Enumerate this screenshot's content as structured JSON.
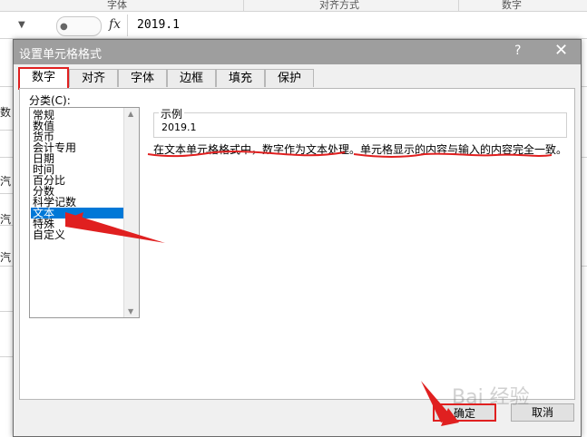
{
  "ribbon": {
    "groups": [
      "字体",
      "对齐方式",
      "数字"
    ]
  },
  "formula_bar": {
    "fx_label": "fx",
    "value": "2019.1"
  },
  "sheet": {
    "left_fragments": [
      "数",
      "汽",
      "汽",
      "汽"
    ]
  },
  "dialog": {
    "title": "设置单元格格式",
    "help": "?",
    "close": "✕",
    "tabs": [
      {
        "label": "数字",
        "active": true
      },
      {
        "label": "对齐",
        "active": false
      },
      {
        "label": "字体",
        "active": false
      },
      {
        "label": "边框",
        "active": false
      },
      {
        "label": "填充",
        "active": false
      },
      {
        "label": "保护",
        "active": false
      }
    ],
    "category_label": "分类(C):",
    "categories": [
      "常规",
      "数值",
      "货币",
      "会计专用",
      "日期",
      "时间",
      "百分比",
      "分数",
      "科学记数",
      "文本",
      "特殊",
      "自定义"
    ],
    "selected_category": "文本",
    "sample_label": "示例",
    "sample_value": "2019.1",
    "description_part1": "在文本单元格格式中，数字作为文本处理。",
    "description_part2": "单元格显示的内容与输入的内容完全一致。",
    "ok_label": "确定",
    "cancel_label": "取消"
  },
  "annotation_color": "#e02020",
  "selection_color": "#0078d7",
  "watermark": "Bai 经验"
}
